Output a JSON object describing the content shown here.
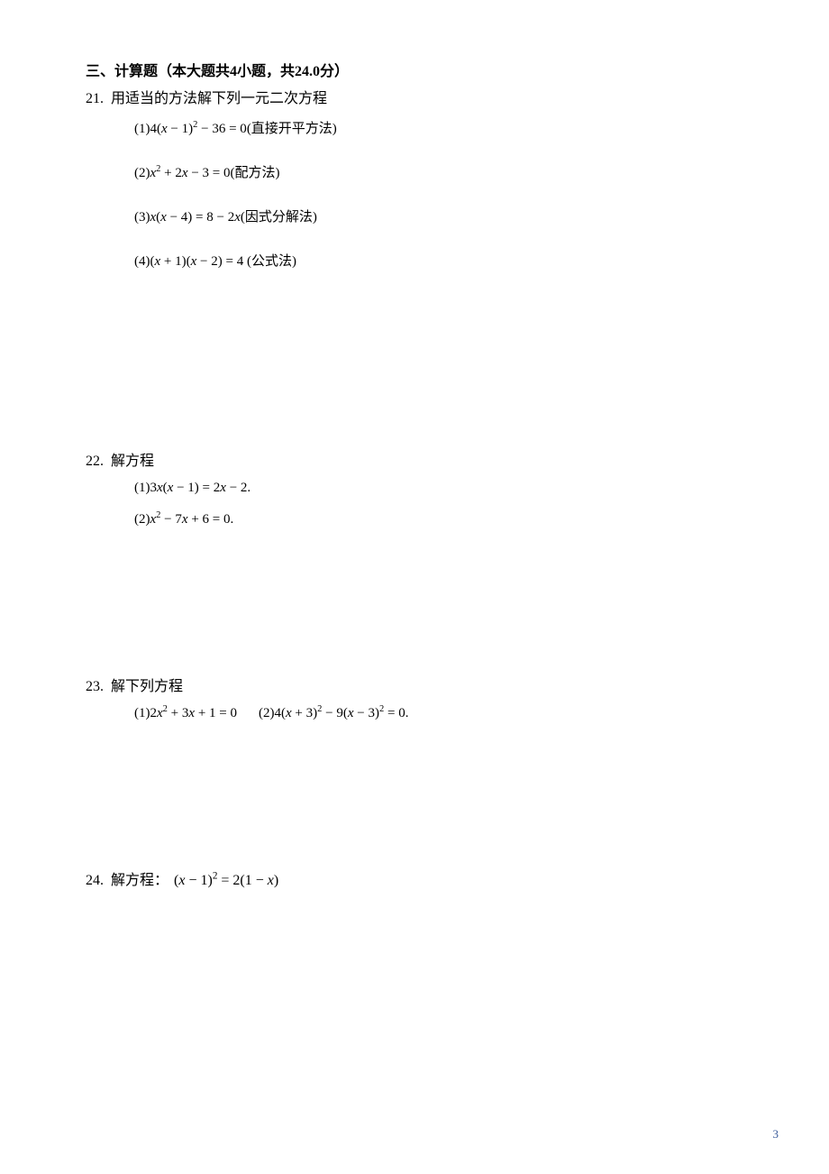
{
  "section": {
    "title": "三、计算题（本大题共4小题，共24.0分）"
  },
  "q21": {
    "number": "21.",
    "prompt": "用适当的方法解下列一元二次方程",
    "items": {
      "a": {
        "label": "(1)",
        "expr": "4(x − 1)² − 36 = 0",
        "note": "(直接开平方法)"
      },
      "b": {
        "label": "(2)",
        "expr": "x² + 2x − 3 = 0",
        "note": "(配方法)"
      },
      "c": {
        "label": "(3)",
        "expr": "x(x − 4) = 8 − 2x",
        "note": "(因式分解法)"
      },
      "d": {
        "label": "(4)",
        "expr": "(x + 1)(x − 2) = 4",
        "note": " (公式法)"
      }
    }
  },
  "q22": {
    "number": "22.",
    "prompt": "解方程",
    "items": {
      "a": {
        "label": "(1)",
        "expr": "3x(x − 1) = 2x − 2",
        "suffix": "."
      },
      "b": {
        "label": "(2)",
        "expr": "x² − 7x + 6 = 0",
        "suffix": "."
      }
    }
  },
  "q23": {
    "number": "23.",
    "prompt": "解下列方程",
    "items": {
      "a": {
        "label": "(1)",
        "expr": "2x² + 3x + 1 = 0"
      },
      "b": {
        "label": "(2)",
        "expr": "4(x + 3)² − 9(x − 3)² = 0",
        "suffix": "."
      }
    }
  },
  "q24": {
    "number": "24.",
    "prompt": "解方程：",
    "expr": "(x − 1)² = 2(1 − x)"
  },
  "pageNumber": "3"
}
